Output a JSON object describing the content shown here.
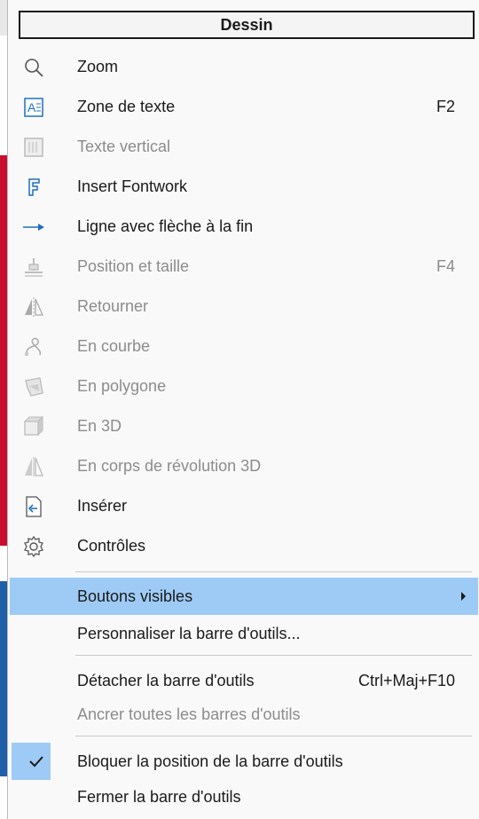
{
  "menu": {
    "title": "Dessin",
    "items": [
      {
        "label": "Zoom",
        "shortcut": "",
        "enabled": true,
        "icon": "zoom-icon"
      },
      {
        "label": "Zone de texte",
        "shortcut": "F2",
        "enabled": true,
        "icon": "text-box-icon"
      },
      {
        "label": "Texte vertical",
        "shortcut": "",
        "enabled": false,
        "icon": "vertical-text-icon"
      },
      {
        "label": "Insert Fontwork",
        "shortcut": "",
        "enabled": true,
        "icon": "fontwork-icon"
      },
      {
        "label": "Ligne avec flèche à la fin",
        "shortcut": "",
        "enabled": true,
        "icon": "arrow-line-icon"
      },
      {
        "label": "Position et taille",
        "shortcut": "F4",
        "enabled": false,
        "icon": "position-size-icon"
      },
      {
        "label": "Retourner",
        "shortcut": "",
        "enabled": false,
        "icon": "flip-icon"
      },
      {
        "label": "En courbe",
        "shortcut": "",
        "enabled": false,
        "icon": "curve-icon"
      },
      {
        "label": "En polygone",
        "shortcut": "",
        "enabled": false,
        "icon": "polygon-icon"
      },
      {
        "label": "En 3D",
        "shortcut": "",
        "enabled": false,
        "icon": "3d-icon"
      },
      {
        "label": "En corps de révolution 3D",
        "shortcut": "",
        "enabled": false,
        "icon": "rotation-body-icon"
      },
      {
        "label": "Insérer",
        "shortcut": "",
        "enabled": true,
        "icon": "insert-icon"
      },
      {
        "label": "Contrôles",
        "shortcut": "",
        "enabled": true,
        "icon": "controls-gear-icon"
      }
    ],
    "visible_buttons": {
      "label": "Boutons visibles",
      "has_submenu": true
    },
    "customize": {
      "label": "Personnaliser la barre d'outils..."
    },
    "detach": {
      "label": "Détacher la barre d'outils",
      "shortcut": "Ctrl+Maj+F10"
    },
    "dock_all": {
      "label": "Ancrer toutes les barres d'outils",
      "enabled": false
    },
    "lock": {
      "label": "Bloquer la position de la barre d'outils",
      "checked": true
    },
    "close": {
      "label": "Fermer la barre d'outils"
    }
  },
  "colors": {
    "highlight": "#9ecbf5",
    "icon_blue": "#1f6fbf",
    "disabled": "#8c8c8c"
  }
}
